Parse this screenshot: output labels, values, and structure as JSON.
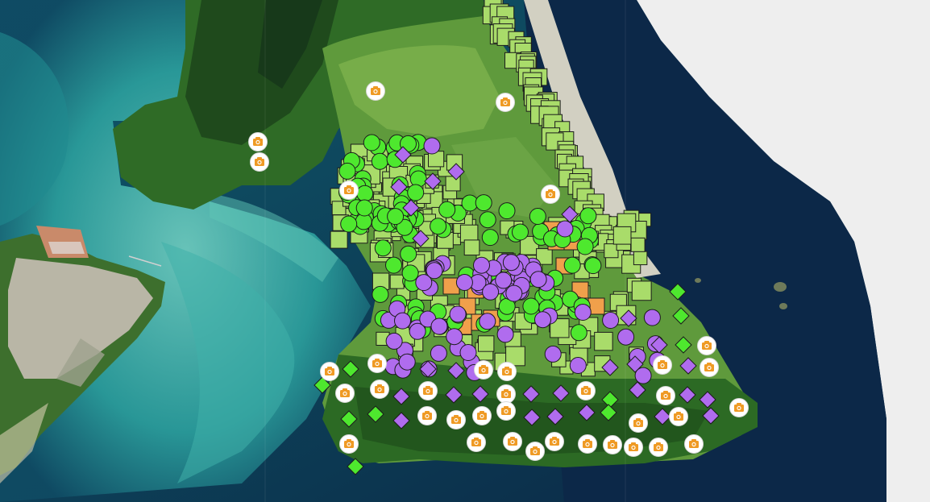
{
  "map": {
    "attribution": "",
    "colors": {
      "background": "#eeeeee",
      "ocean_deep": "#0d2a4a",
      "ocean_mid": "#0f4a63",
      "shallow_turquoise": "#2a9b9a",
      "shallow_light": "#5cc3b8",
      "land_dark_forest": "#1f4a1c",
      "land_forest": "#2f6b26",
      "land_pasture": "#5f9a3c",
      "land_pasture_light": "#7db24c",
      "urban": "#b9b6a6",
      "sand": "#e8e2cf"
    },
    "layers": [
      {
        "name": "parcels",
        "symbol": "square",
        "fill": "#a9dc6a",
        "stroke": "#1c1c1c",
        "count": 260
      },
      {
        "name": "orange-parcels",
        "symbol": "square",
        "fill": "#f0a04b",
        "stroke": "#1c1c1c",
        "count": 12
      },
      {
        "name": "green-circle-sites",
        "symbol": "circle",
        "fill": "#4ee82e",
        "stroke": "#1c1c1c",
        "count": 120
      },
      {
        "name": "purple-circle-sites",
        "symbol": "circle",
        "fill": "#b06cee",
        "stroke": "#1c1c1c",
        "count": 70
      },
      {
        "name": "purple-diamond-sites",
        "symbol": "diamond",
        "fill": "#b06cee",
        "stroke": "#1c1c1c",
        "count": 35
      },
      {
        "name": "green-diamond-sites",
        "symbol": "diamond",
        "fill": "#4ee82e",
        "stroke": "#1c1c1c",
        "count": 10
      },
      {
        "name": "photo-markers",
        "symbol": "camera-icon",
        "fill": "#ffffff",
        "icon_color": "#ef9a24",
        "count": 48
      }
    ]
  }
}
